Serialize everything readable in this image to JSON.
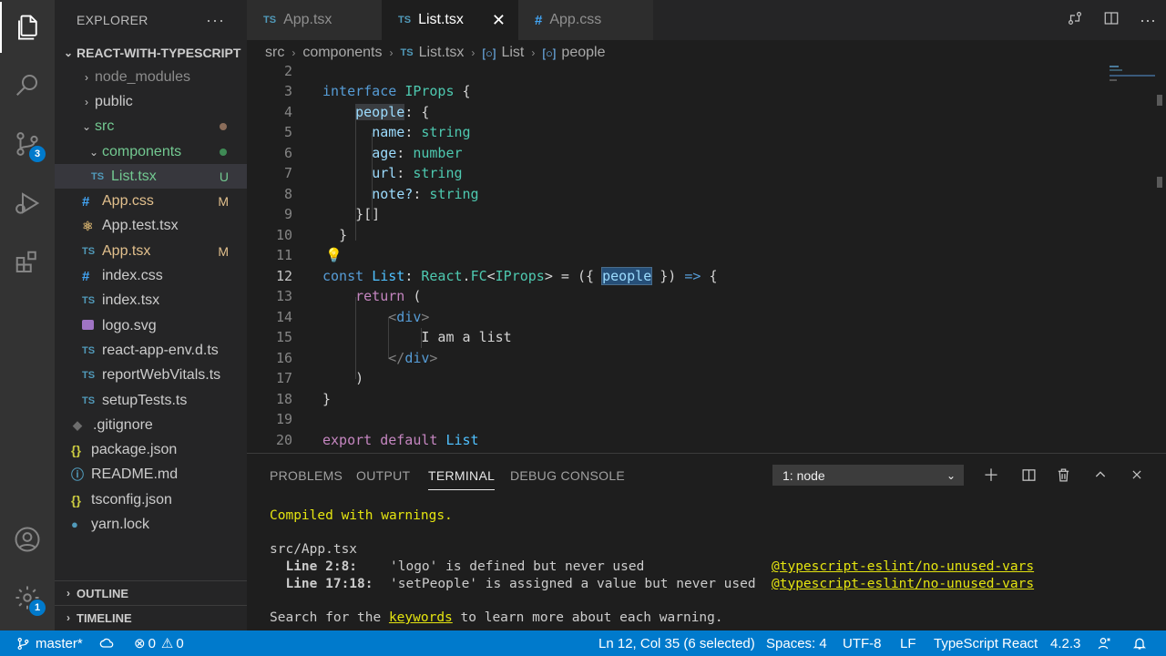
{
  "activity_bar": {
    "scm_badge": "3",
    "manage_badge": "1"
  },
  "explorer": {
    "title": "EXPLORER",
    "more": "···",
    "project": "REACT-WITH-TYPESCRIPT",
    "items": [
      {
        "label": "node_modules",
        "status": ""
      },
      {
        "label": "public",
        "status": ""
      },
      {
        "label": "src",
        "status": ""
      },
      {
        "label": "components",
        "status": ""
      },
      {
        "label": "List.tsx",
        "icon": "TS",
        "status": "U"
      },
      {
        "label": "App.css",
        "icon": "#",
        "status": "M"
      },
      {
        "label": "App.test.tsx",
        "status": ""
      },
      {
        "label": "App.tsx",
        "icon": "TS",
        "status": "M"
      },
      {
        "label": "index.css",
        "icon": "#",
        "status": ""
      },
      {
        "label": "index.tsx",
        "icon": "TS",
        "status": ""
      },
      {
        "label": "logo.svg",
        "status": ""
      },
      {
        "label": "react-app-env.d.ts",
        "icon": "TS",
        "status": ""
      },
      {
        "label": "reportWebVitals.ts",
        "icon": "TS",
        "status": ""
      },
      {
        "label": "setupTests.ts",
        "icon": "TS",
        "status": ""
      },
      {
        "label": ".gitignore",
        "status": ""
      },
      {
        "label": "package.json",
        "icon": "{}",
        "status": ""
      },
      {
        "label": "README.md",
        "status": ""
      },
      {
        "label": "tsconfig.json",
        "icon": "{}",
        "status": ""
      },
      {
        "label": "yarn.lock",
        "status": ""
      }
    ],
    "outline": "OUTLINE",
    "timeline": "TIMELINE"
  },
  "tabs": [
    {
      "icon": "TS",
      "label": "App.tsx"
    },
    {
      "icon": "TS",
      "label": "List.tsx",
      "close": "✕"
    },
    {
      "icon": "#",
      "label": "App.css"
    }
  ],
  "breadcrumb": {
    "parts": [
      "src",
      "components",
      "List.tsx",
      "List",
      "people"
    ],
    "file_icon": "TS"
  },
  "editor": {
    "line_numbers": [
      "2",
      "3",
      "4",
      "5",
      "6",
      "7",
      "8",
      "9",
      "10",
      "11",
      "12",
      "13",
      "14",
      "15",
      "16",
      "17",
      "18",
      "19",
      "20"
    ],
    "cursor_line": "12 ",
    "code": {
      "l3_kw": "interface",
      "l3_name": "IProps",
      "l3_rest": " {",
      "l4_prop": "people",
      "l4_rest": ": {",
      "l5_prop": "name",
      "l5_type": "string",
      "l6_prop": "age",
      "l6_type": "number",
      "l7_prop": "url",
      "l7_type": "string",
      "l8_prop": "note?",
      "l8_type": "string",
      "l9": "}[]",
      "l10": "}",
      "l12_const": "const",
      "l12_name": "List",
      "l12_react": "React",
      "l12_fc": "FC",
      "l12_iprops": "IProps",
      "l12_people": "people",
      "l12_arrow": "=>",
      "l13_return": "return",
      "l13_rest": " (",
      "l14_open": "<",
      "l14_tag": "div",
      "l14_close": ">",
      "l15": "I am a list",
      "l16_open": "</",
      "l16_tag": "div",
      "l16_close": ">",
      "l17": ")",
      "l18": "}",
      "l20_export": "export",
      "l20_default": "default",
      "l20_name": "List"
    }
  },
  "panel": {
    "tabs": [
      "PROBLEMS",
      "OUTPUT",
      "TERMINAL",
      "DEBUG CONSOLE"
    ],
    "terminal_select": "1: node",
    "terminal": {
      "compiled": "Compiled with warnings.",
      "file": "src/App.tsx",
      "w1_loc": "Line 2:8:",
      "w1_msg": "'logo' is defined but never used",
      "w1_rule": "@typescript-eslint/no-unused-vars",
      "w2_loc": "Line 17:18:",
      "w2_msg": "'setPeople' is assigned a value but never used",
      "w2_rule": "@typescript-eslint/no-unused-vars",
      "search_pre": "Search for the ",
      "search_kw": "keywords",
      "search_post": " to learn more about each warning."
    }
  },
  "statusbar": {
    "branch": "master*",
    "errors": "0",
    "warnings": "0",
    "position": "Ln 12, Col 35 (6 selected)",
    "spaces": "Spaces: 4",
    "encoding": "UTF-8",
    "eol": "LF",
    "language": "TypeScript React",
    "version": "4.2.3"
  },
  "colors": {
    "accent": "#007acc",
    "statusbar": "#007acc",
    "editor_bg": "#1e1e1e"
  }
}
